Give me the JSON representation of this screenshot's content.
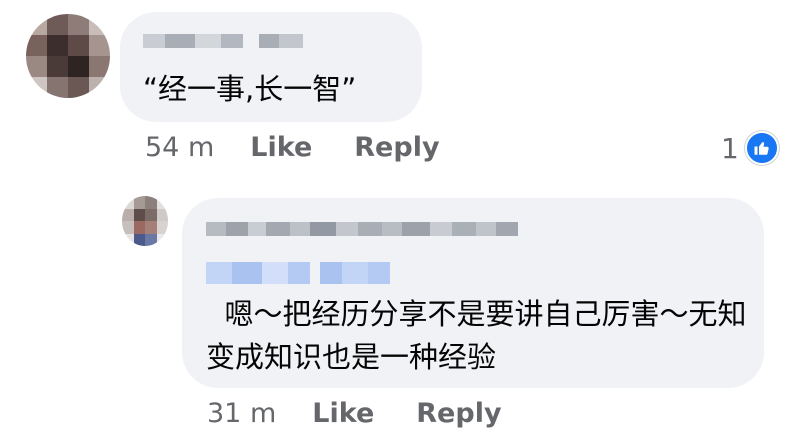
{
  "comment1": {
    "text": "“经一事,长一智”",
    "time": "54 m",
    "like_label": "Like",
    "reply_label": "Reply",
    "reaction_count": "1",
    "reaction_icon": "thumbs-up-icon"
  },
  "comment2": {
    "text": "嗯～把经历分享不是要讲自己厉害～无知变成知识也是一种经验",
    "time": "31 m",
    "like_label": "Like",
    "reply_label": "Reply"
  },
  "colors": {
    "bubble": "#f0f2f5",
    "meta_text": "#65676b",
    "like_blue": "#1877f2",
    "mention_blue": "#c7d8f8"
  }
}
